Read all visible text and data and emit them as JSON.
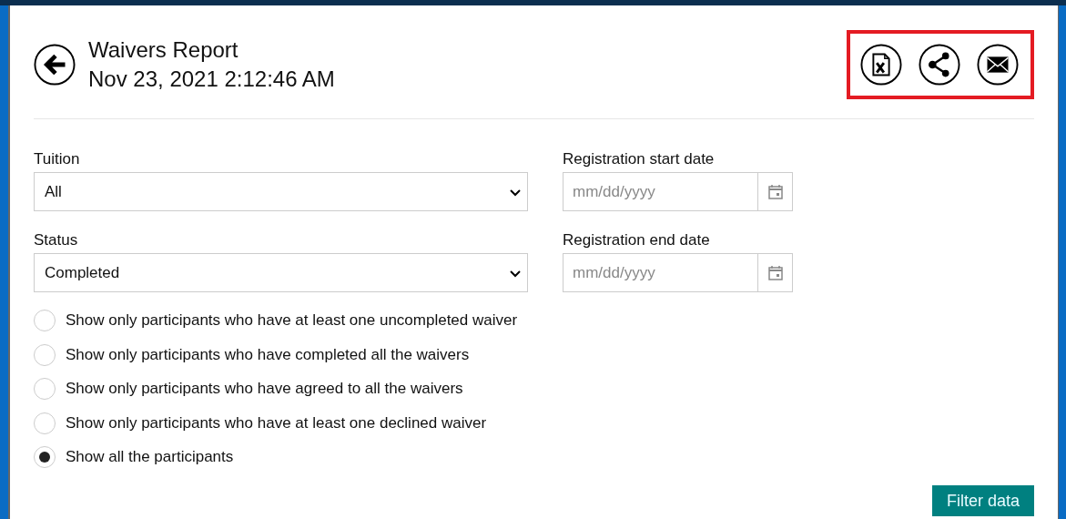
{
  "header": {
    "title": "Waivers Report",
    "date": "Nov 23, 2021 2:12:46 AM"
  },
  "actions": {
    "highlighted": true,
    "items": [
      {
        "kind": "excel"
      },
      {
        "kind": "share"
      },
      {
        "kind": "email"
      }
    ]
  },
  "selects": [
    {
      "label": "Tuition",
      "value": "All"
    },
    {
      "label": "Status",
      "value": "Completed"
    }
  ],
  "date_fields": [
    {
      "label": "Registration start date",
      "placeholder": "mm/dd/yyyy"
    },
    {
      "label": "Registration end date",
      "placeholder": "mm/dd/yyyy"
    }
  ],
  "options": [
    {
      "label": "Show only participants who have at least one uncompleted waiver",
      "selected": false
    },
    {
      "label": "Show only participants who have completed all the waivers",
      "selected": false
    },
    {
      "label": "Show only participants who have agreed to all the waivers",
      "selected": false
    },
    {
      "label": "Show only participants who have at least one declined waiver",
      "selected": false
    },
    {
      "label": "Show all the participants",
      "selected": true
    }
  ],
  "filter_button": "Filter data"
}
